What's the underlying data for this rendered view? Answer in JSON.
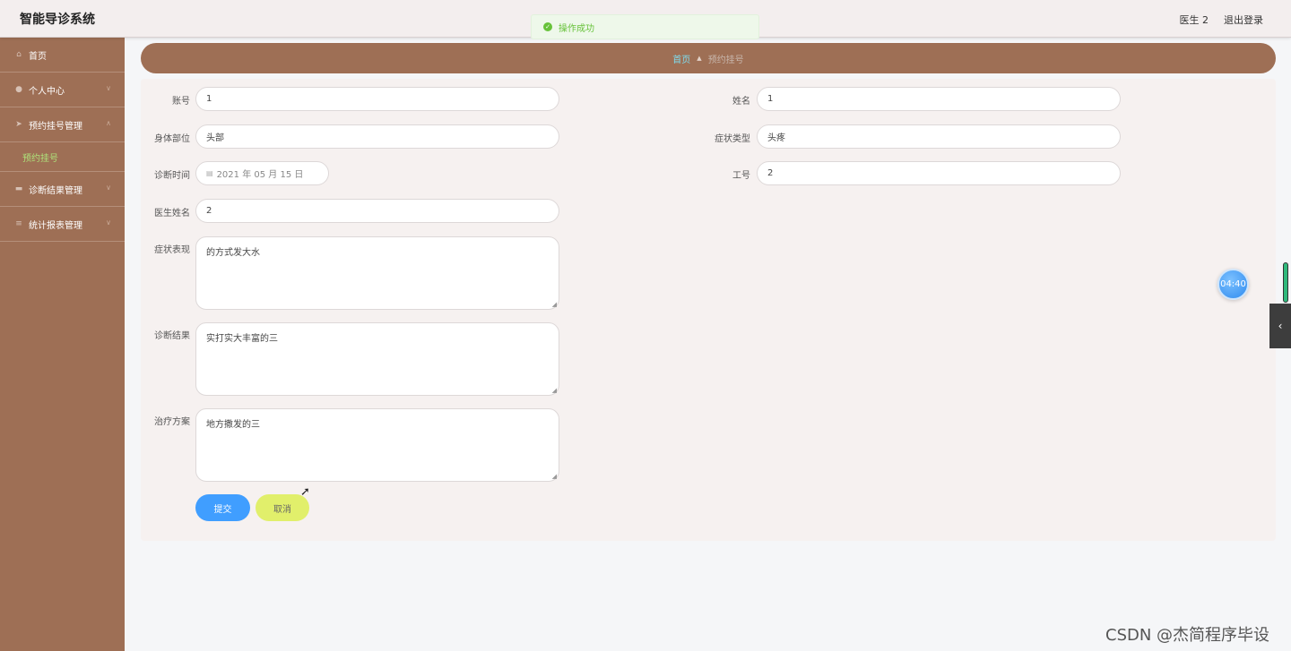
{
  "header": {
    "app_title": "智能导诊系统",
    "user": "医生 2",
    "logout": "退出登录"
  },
  "toast": {
    "message": "操作成功",
    "icon": "check-circle-icon",
    "color": "#67c23a"
  },
  "sidebar": {
    "items": [
      {
        "label": "首页",
        "icon": "home-icon"
      },
      {
        "label": "个人中心",
        "icon": "user-icon"
      },
      {
        "label": "预约挂号管理",
        "icon": "send-icon"
      },
      {
        "label": "诊断结果管理",
        "icon": "monitor-icon"
      },
      {
        "label": "统计报表管理",
        "icon": "list-icon"
      }
    ],
    "active_submenu": "预约挂号"
  },
  "breadcrumb": {
    "home": "首页",
    "current": "预约挂号"
  },
  "form": {
    "account": {
      "label": "账号",
      "value": "1"
    },
    "name": {
      "label": "姓名",
      "value": "1"
    },
    "body_part": {
      "label": "身体部位",
      "value": "头部"
    },
    "symptom_type": {
      "label": "症状类型",
      "value": "头疼"
    },
    "diagnosis_time": {
      "label": "诊断时间",
      "value": "2021 年 05 月 15 日"
    },
    "job_number": {
      "label": "工号",
      "value": "2"
    },
    "doctor_name": {
      "label": "医生姓名",
      "value": "2"
    },
    "symptoms": {
      "label": "症状表现",
      "value": "的方式发大水"
    },
    "diagnosis_result": {
      "label": "诊断结果",
      "value": "实打实大丰富的三"
    },
    "treatment_plan": {
      "label": "治疗方案",
      "value": "地方撒发的三"
    },
    "submit_label": "提交",
    "cancel_label": "取消"
  },
  "widgets": {
    "timer": "04:40"
  },
  "watermark": "CSDN @杰简程序毕设",
  "colors": {
    "sidebar": "#9e6f55",
    "primary": "#409eff",
    "cancel": "#e1ef6b"
  }
}
